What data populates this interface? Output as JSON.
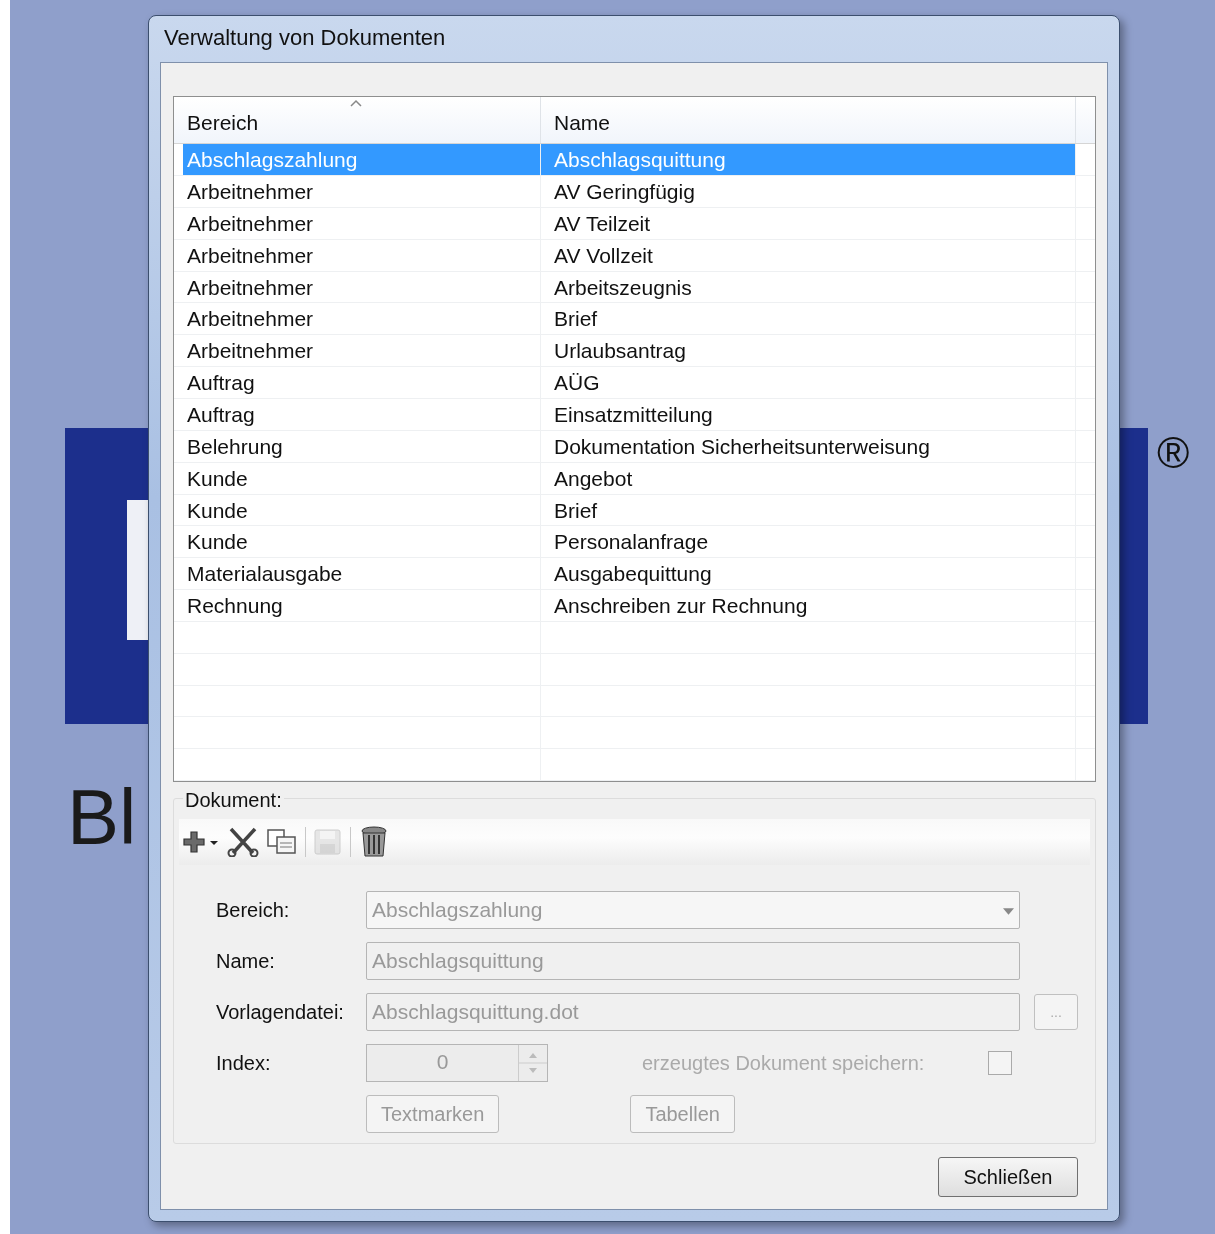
{
  "background": {
    "logo_text": "Bl",
    "trademark": "®"
  },
  "window": {
    "title": "Verwaltung von Dokumenten"
  },
  "table": {
    "columns": [
      {
        "label": "Bereich",
        "sorted": true
      },
      {
        "label": "Name",
        "sorted": false
      }
    ],
    "rows": [
      {
        "cells": [
          "Abschlagszahlung",
          "Abschlagsquittung"
        ],
        "selected": true
      },
      {
        "cells": [
          "Arbeitnehmer",
          "AV Geringfügig"
        ],
        "selected": false
      },
      {
        "cells": [
          "Arbeitnehmer",
          "AV Teilzeit"
        ],
        "selected": false
      },
      {
        "cells": [
          "Arbeitnehmer",
          "AV Vollzeit"
        ],
        "selected": false
      },
      {
        "cells": [
          "Arbeitnehmer",
          "Arbeitszeugnis"
        ],
        "selected": false
      },
      {
        "cells": [
          "Arbeitnehmer",
          "Brief"
        ],
        "selected": false
      },
      {
        "cells": [
          "Arbeitnehmer",
          "Urlaubsantrag"
        ],
        "selected": false
      },
      {
        "cells": [
          "Auftrag",
          "AÜG"
        ],
        "selected": false
      },
      {
        "cells": [
          "Auftrag",
          "Einsatzmitteilung"
        ],
        "selected": false
      },
      {
        "cells": [
          "Belehrung",
          "Dokumentation Sicherheitsunterweisung"
        ],
        "selected": false
      },
      {
        "cells": [
          "Kunde",
          "Angebot"
        ],
        "selected": false
      },
      {
        "cells": [
          "Kunde",
          "Brief"
        ],
        "selected": false
      },
      {
        "cells": [
          "Kunde",
          "Personalanfrage"
        ],
        "selected": false
      },
      {
        "cells": [
          "Materialausgabe",
          "Ausgabequittung"
        ],
        "selected": false
      },
      {
        "cells": [
          "Rechnung",
          "Anschreiben zur Rechnung"
        ],
        "selected": false
      }
    ]
  },
  "document": {
    "label": "Dokument:",
    "toolbar": [
      {
        "kind": "add",
        "disabled": false
      },
      {
        "kind": "cut",
        "disabled": false
      },
      {
        "kind": "copy",
        "disabled": false
      },
      {
        "kind": "separator"
      },
      {
        "kind": "save",
        "disabled": true
      },
      {
        "kind": "separator"
      },
      {
        "kind": "delete",
        "disabled": false
      }
    ],
    "fields": [
      {
        "kind": "dropdown",
        "label": "Bereich:",
        "value": "Abschlagszahlung",
        "disabled": true
      },
      {
        "kind": "text",
        "label": "Name:",
        "value": "Abschlagsquittung",
        "disabled": true
      },
      {
        "kind": "file",
        "label": "Vorlagendatei:",
        "value": "Abschlagsquittung.dot",
        "disabled": true,
        "browse": "..."
      },
      {
        "kind": "spinner",
        "label": "Index:",
        "value": "0",
        "disabled": true
      }
    ],
    "checkbox": {
      "label": "erzeugtes Dokument speichern:",
      "checked": false,
      "disabled": true
    },
    "buttons": [
      {
        "label": "Textmarken",
        "disabled": true
      },
      {
        "label": "Tabellen",
        "disabled": true
      }
    ]
  },
  "close_button": {
    "label": "Schließen",
    "disabled": false
  }
}
